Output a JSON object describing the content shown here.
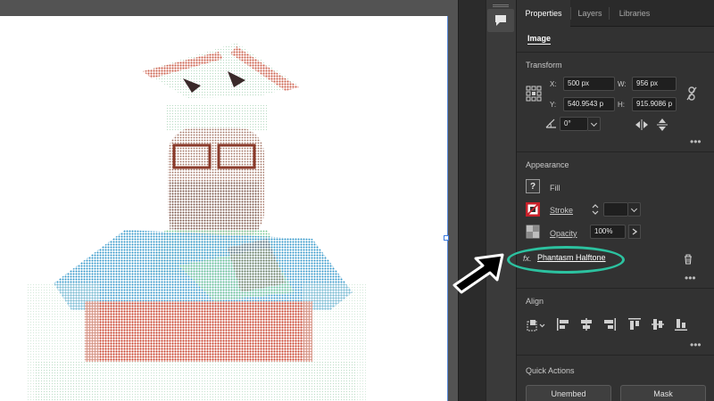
{
  "tabs": [
    {
      "label": "Properties",
      "active": true
    },
    {
      "label": "Layers",
      "active": false
    },
    {
      "label": "Libraries",
      "active": false
    }
  ],
  "object_type": "Image",
  "transform": {
    "title": "Transform",
    "x_label": "X:",
    "x_value": "500 px",
    "y_label": "Y:",
    "y_value": "540.9543 p",
    "w_label": "W:",
    "w_value": "956 px",
    "h_label": "H:",
    "h_value": "915.9086 p",
    "angle_value": "0°"
  },
  "appearance": {
    "title": "Appearance",
    "fill_label": "Fill",
    "stroke_label": "Stroke",
    "opacity_label": "Opacity",
    "opacity_value": "100%",
    "effect_label": "Phantasm Halftone",
    "fx_symbol": "fx."
  },
  "align": {
    "title": "Align"
  },
  "quick_actions": {
    "title": "Quick Actions",
    "unembed_label": "Unembed",
    "mask_label": "Mask"
  },
  "more_glyph": "•••",
  "fill_glyph": "?",
  "colors": {
    "accent_highlight": "#2cc2a0",
    "panel_bg": "#323232",
    "selection_blue": "#5b8bd9"
  },
  "icons": [
    "speech-bubble-icon",
    "reference-point-icon",
    "link-constrain-icon",
    "angle-icon",
    "flip-horizontal-icon",
    "flip-vertical-icon",
    "trash-icon",
    "align-to-icon",
    "align-left-icon",
    "align-center-h-icon",
    "align-right-icon",
    "align-top-icon",
    "align-center-v-icon",
    "align-bottom-icon"
  ]
}
